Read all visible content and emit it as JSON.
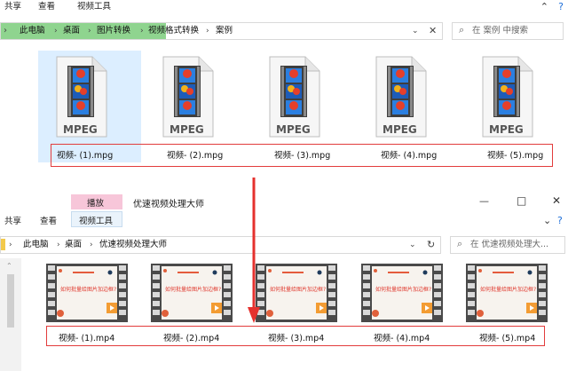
{
  "window_top": {
    "ribbon_tabs": [
      "共享",
      "查看",
      "视频工具"
    ],
    "window_controls": [
      "—",
      "□",
      "✕"
    ],
    "breadcrumb": [
      "此电脑",
      "桌面",
      "图片转换",
      "视频格式转换",
      "案例"
    ],
    "search_placeholder": "在 案例 中搜索",
    "icon_label": "MPEG",
    "files": [
      "视频- (1).mpg",
      "视频- (2).mpg",
      "视频- (3).mpg",
      "视频- (4).mpg",
      "视频- (5).mpg"
    ]
  },
  "window_bottom": {
    "context_tab": "播放",
    "window_title": "优速视频处理大师",
    "ribbon_tabs": [
      "共享",
      "查看",
      "视频工具"
    ],
    "window_controls": [
      "—",
      "□",
      "✕"
    ],
    "breadcrumb": [
      "此电脑",
      "桌面",
      "优速视频处理大师"
    ],
    "search_placeholder": "在 优速视频处理大...",
    "thumbnail_title": "如何批量给图片加边框?",
    "files": [
      "视频- (1).mp4",
      "视频- (2).mp4",
      "视频- (3).mp4",
      "视频- (4).mp4",
      "视频- (5).mp4"
    ]
  },
  "colors": {
    "highlight_green": "#8fd48f",
    "selected_tile": "#dceeff",
    "red_box": "#e23c3c",
    "context_tab_pink": "#f7c6d9",
    "arrow_red": "#e5312e"
  }
}
